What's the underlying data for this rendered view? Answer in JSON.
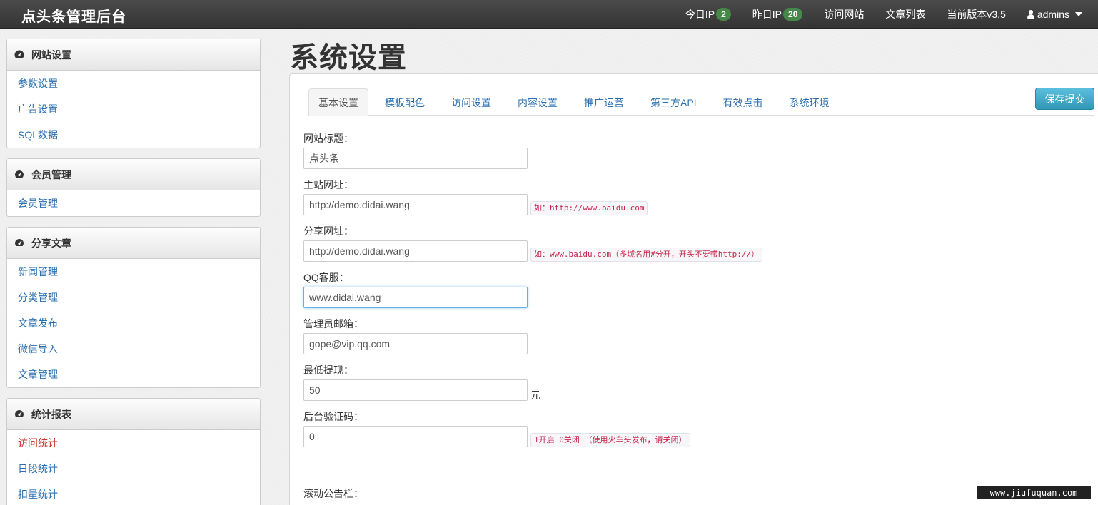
{
  "navbar": {
    "brand": "点头条管理后台",
    "today_ip_label": "今日IP",
    "today_ip_count": "2",
    "yesterday_ip_label": "昨日IP",
    "yesterday_ip_count": "20",
    "visit_site": "访问网站",
    "article_list": "文章列表",
    "version": "当前版本v3.5",
    "user": "admins"
  },
  "sidebar": {
    "panels": [
      {
        "title": "网站设置",
        "items": [
          "参数设置",
          "广告设置",
          "SQL数据"
        ]
      },
      {
        "title": "会员管理",
        "items": [
          "会员管理"
        ]
      },
      {
        "title": "分享文章",
        "items": [
          "新闻管理",
          "分类管理",
          "文章发布",
          "微信导入",
          "文章管理"
        ]
      },
      {
        "title": "统计报表",
        "items": [
          "访问统计",
          "日段统计",
          "扣量统计"
        ],
        "active_item": "访问统计"
      }
    ]
  },
  "main": {
    "title": "系统设置",
    "tabs": [
      "基本设置",
      "模板配色",
      "访问设置",
      "内容设置",
      "推广运营",
      "第三方API",
      "有效点击",
      "系统环境"
    ],
    "active_tab": "基本设置",
    "save_label": "保存提交",
    "fields": [
      {
        "label": "网站标题：",
        "value": "点头条"
      },
      {
        "label": "主站网址：",
        "value": "http://demo.didai.wang",
        "hint": "如：http://www.baidu.com"
      },
      {
        "label": "分享网址：",
        "value": "http://demo.didai.wang",
        "hint": "如：www.baidu.com（多域名用#分开，开头不要带http://）"
      },
      {
        "label": "QQ客服：",
        "value": "www.didai.wang"
      },
      {
        "label": "管理员邮箱：",
        "value": "gope@vip.qq.com"
      },
      {
        "label": "最低提现：",
        "value": "50",
        "unit": "元"
      },
      {
        "label": "后台验证码：",
        "value": "0",
        "hint": "1开启 0关闭 （使用火车头发布，请关闭）"
      }
    ],
    "scroll_notice_label": "滚动公告栏："
  },
  "watermark": "www.jiufuquan.com",
  "colors": {
    "navbar": "#3c3c3c",
    "link": "#2a6fb0",
    "active_link": "#c9302c",
    "badge": "#468847",
    "save_button": "#49afcd",
    "hint_text": "#c7254e"
  }
}
